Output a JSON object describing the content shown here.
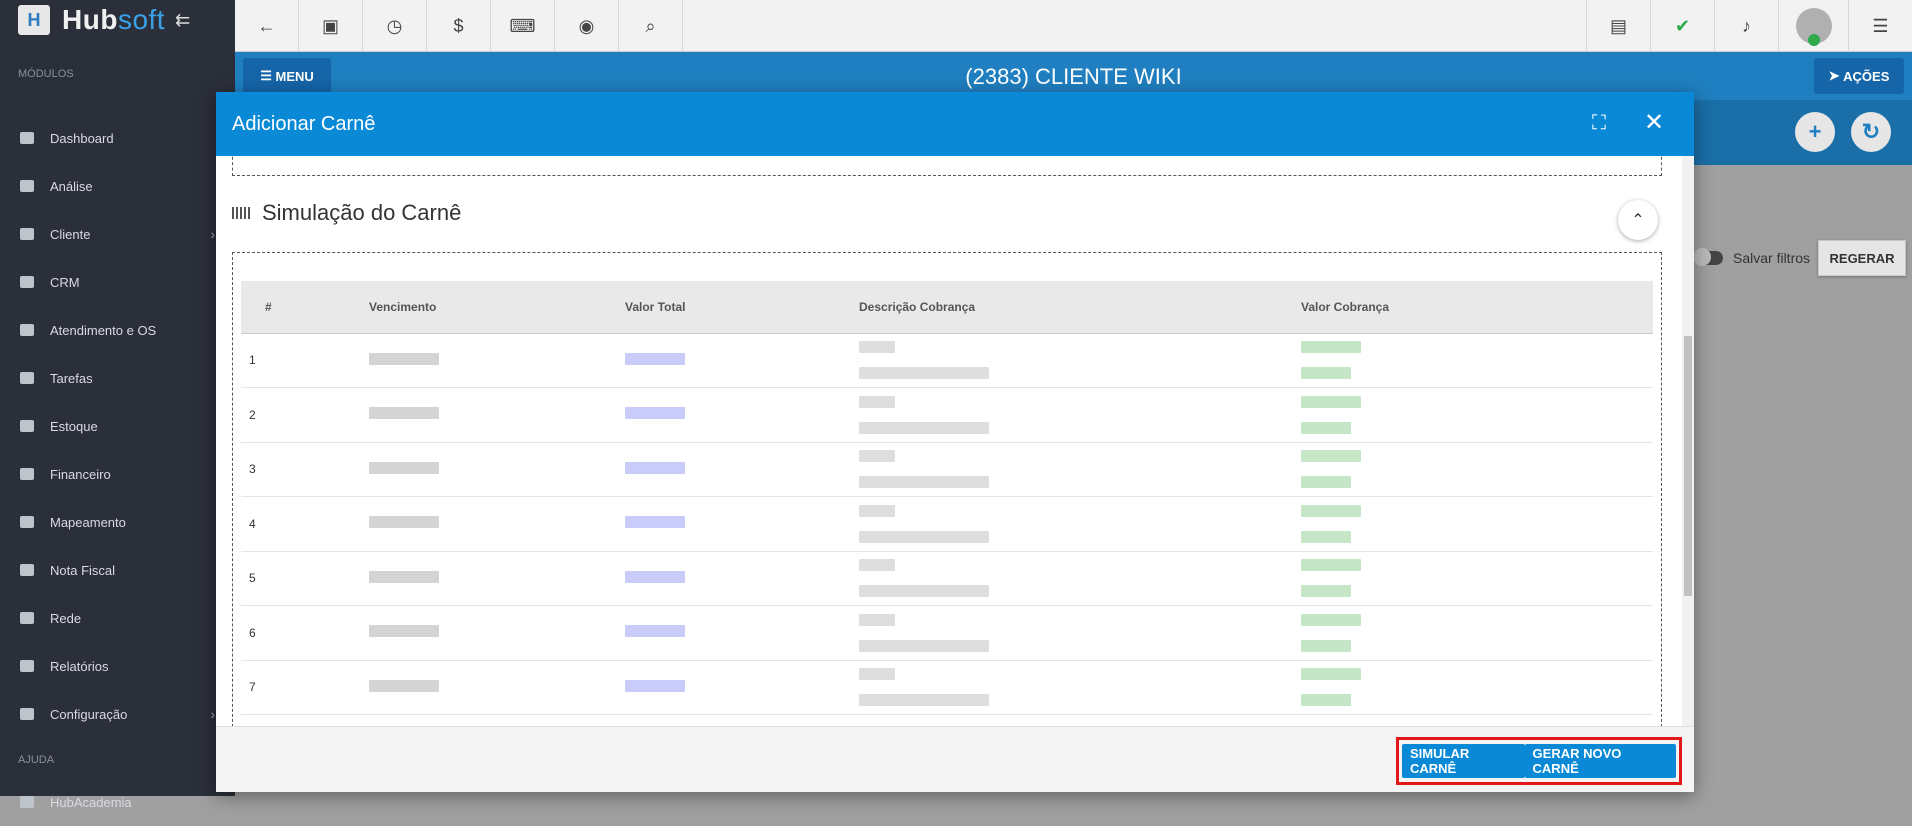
{
  "brand": {
    "logo_main": "Hub",
    "logo_accent": "soft"
  },
  "sidebar": {
    "section_modules": "MÓDULOS",
    "items": [
      {
        "label": "Dashboard",
        "has_children": false
      },
      {
        "label": "Análise",
        "has_children": false
      },
      {
        "label": "Cliente",
        "has_children": true
      },
      {
        "label": "CRM",
        "has_children": false
      },
      {
        "label": "Atendimento e OS",
        "has_children": false
      },
      {
        "label": "Tarefas",
        "has_children": false
      },
      {
        "label": "Estoque",
        "has_children": false
      },
      {
        "label": "Financeiro",
        "has_children": false
      },
      {
        "label": "Mapeamento",
        "has_children": false
      },
      {
        "label": "Nota Fiscal",
        "has_children": false
      },
      {
        "label": "Rede",
        "has_children": false
      },
      {
        "label": "Relatórios",
        "has_children": false
      },
      {
        "label": "Configuração",
        "has_children": true
      }
    ],
    "section_help": "AJUDA",
    "help_items": [
      {
        "label": "HubAcademia"
      }
    ]
  },
  "header": {
    "menu_label": "MENU",
    "client_title": "(2383) CLIENTE WIKI",
    "actions_label": "AÇÕES"
  },
  "filters": {
    "save_filters_label": "Salvar filtros",
    "regenerate_label": "REGERAR"
  },
  "modal": {
    "title": "Adicionar Carnê",
    "section_title": "Simulação do Carnê",
    "table": {
      "headers": [
        "#",
        "Vencimento",
        "Valor Total",
        "Descrição Cobrança",
        "Valor Cobrança"
      ],
      "rows": [
        "1",
        "2",
        "3",
        "4",
        "5",
        "6",
        "7"
      ]
    },
    "buttons": {
      "simulate": "SIMULAR CARNÊ",
      "generate": "GERAR NOVO CARNÊ"
    }
  },
  "colors": {
    "primary": "#0a8ad6",
    "sidebar_bg": "#2b2f3a",
    "highlight": "#e01818"
  }
}
